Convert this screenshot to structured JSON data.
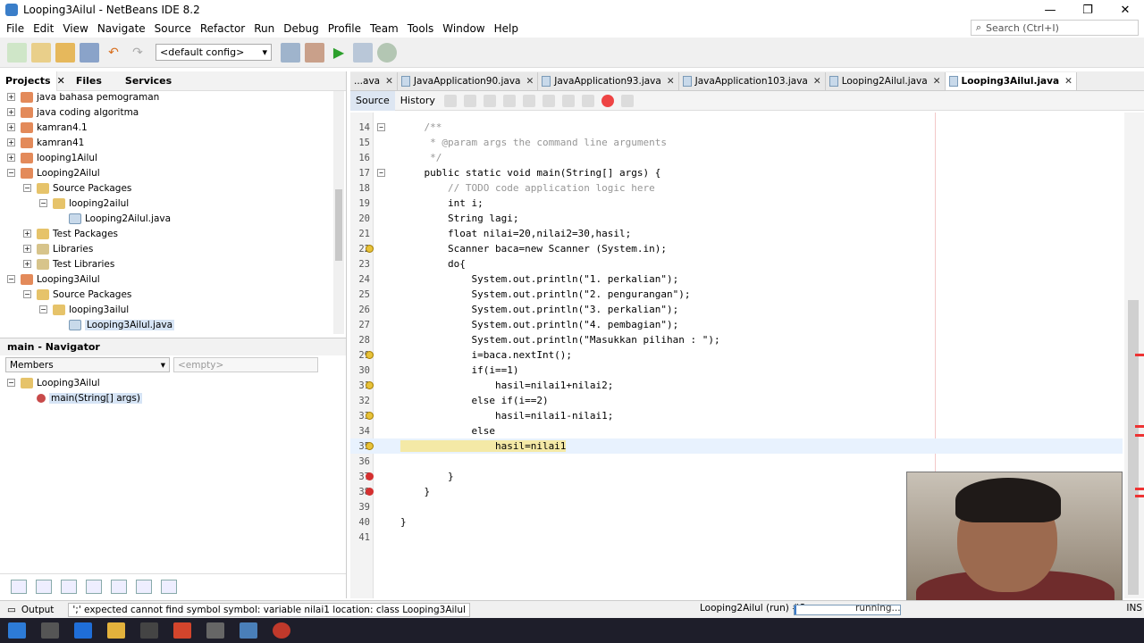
{
  "window": {
    "title": "Looping3Ailul - NetBeans IDE 8.2",
    "minimize": "—",
    "maximize": "❐",
    "close": "✕"
  },
  "menu": [
    "File",
    "Edit",
    "View",
    "Navigate",
    "Source",
    "Refactor",
    "Run",
    "Debug",
    "Profile",
    "Team",
    "Tools",
    "Window",
    "Help"
  ],
  "search": {
    "placeholder": "Search (Ctrl+I)"
  },
  "toolbar": {
    "config": "<default config>"
  },
  "projects_panel": {
    "tabs": [
      "Projects",
      "Files",
      "Services"
    ],
    "tree": [
      {
        "label": "java bahasa pemograman",
        "type": "project",
        "expander": "+"
      },
      {
        "label": "java coding algoritma",
        "type": "project",
        "expander": "+"
      },
      {
        "label": "kamran4.1",
        "type": "project",
        "expander": "+"
      },
      {
        "label": "kamran41",
        "type": "project",
        "expander": "+"
      },
      {
        "label": "looping1Ailul",
        "type": "project",
        "expander": "+"
      },
      {
        "label": "Looping2Ailul",
        "type": "project",
        "expander": "−"
      },
      {
        "label": "Source Packages",
        "type": "package",
        "expander": "−"
      },
      {
        "label": "looping2ailul",
        "type": "package",
        "expander": "−"
      },
      {
        "label": "Looping2Ailul.java",
        "type": "java",
        "expander": ""
      },
      {
        "label": "Test Packages",
        "type": "package",
        "expander": "+"
      },
      {
        "label": "Libraries",
        "type": "library",
        "expander": "+"
      },
      {
        "label": "Test Libraries",
        "type": "library",
        "expander": "+"
      },
      {
        "label": "Looping3Ailul",
        "type": "project",
        "expander": "−"
      },
      {
        "label": "Source Packages",
        "type": "package",
        "expander": "−"
      },
      {
        "label": "looping3ailul",
        "type": "package",
        "expander": "−"
      },
      {
        "label": "Looping3Ailul.java",
        "type": "java",
        "expander": ""
      }
    ]
  },
  "navigator": {
    "title": "main - Navigator",
    "filter": "Members",
    "empty": "<empty>",
    "tree": [
      {
        "label": "Looping3Ailul",
        "expander": "−"
      },
      {
        "label": "main(String[] args)",
        "expander": ""
      }
    ]
  },
  "editor": {
    "tabs": [
      {
        "label": "...ava",
        "active": false,
        "icon": false
      },
      {
        "label": "JavaApplication90.java",
        "active": false,
        "icon": true
      },
      {
        "label": "JavaApplication93.java",
        "active": false,
        "icon": true
      },
      {
        "label": "JavaApplication103.java",
        "active": false,
        "icon": true
      },
      {
        "label": "Looping2Ailul.java",
        "active": false,
        "icon": true
      },
      {
        "label": "Looping3Ailul.java",
        "active": true,
        "icon": true
      }
    ],
    "source_tabs": [
      "Source",
      "History"
    ],
    "lines": [
      {
        "n": "14",
        "t": "    /**"
      },
      {
        "n": "15",
        "t": "     * @param args the command line arguments"
      },
      {
        "n": "16",
        "t": "     */"
      },
      {
        "n": "17",
        "t": "    public static void main(String[] args) {"
      },
      {
        "n": "18",
        "t": "        // TODO code application logic here"
      },
      {
        "n": "19",
        "t": "        int i;"
      },
      {
        "n": "20",
        "t": "        String lagi;"
      },
      {
        "n": "21",
        "t": "        float nilai=20,nilai2=30,hasil;"
      },
      {
        "n": "22",
        "t": "        Scanner baca=new Scanner (System.in);"
      },
      {
        "n": "23",
        "t": "        do{"
      },
      {
        "n": "24",
        "t": "            System.out.println(\"1. perkalian\");"
      },
      {
        "n": "25",
        "t": "            System.out.println(\"2. pengurangan\");"
      },
      {
        "n": "26",
        "t": "            System.out.println(\"3. perkalian\");"
      },
      {
        "n": "27",
        "t": "            System.out.println(\"4. pembagian\");"
      },
      {
        "n": "28",
        "t": "            System.out.println(\"Masukkan pilihan : \");"
      },
      {
        "n": "29",
        "t": "            i=baca.nextInt();"
      },
      {
        "n": "30",
        "t": "            if(i==1)"
      },
      {
        "n": "31",
        "t": "                hasil=nilai1+nilai2;"
      },
      {
        "n": "32",
        "t": "            else if(i==2)"
      },
      {
        "n": "33",
        "t": "                hasil=nilai1-nilai1;"
      },
      {
        "n": "34",
        "t": "            else"
      },
      {
        "n": "35",
        "t": "                hasil=nilai1"
      },
      {
        "n": "36",
        "t": ""
      },
      {
        "n": "37",
        "t": "        }"
      },
      {
        "n": "38",
        "t": "    }"
      },
      {
        "n": "39",
        "t": ""
      },
      {
        "n": "40",
        "t": "}"
      },
      {
        "n": "41",
        "t": ""
      }
    ]
  },
  "status": {
    "output_tab": "Output",
    "message": "';' expected  cannot find symbol  symbol:  variable nilai1  location: class Looping3Ailul",
    "run_label": "Looping2Ailul (run) #2",
    "running": "running...",
    "mode": "INS"
  }
}
